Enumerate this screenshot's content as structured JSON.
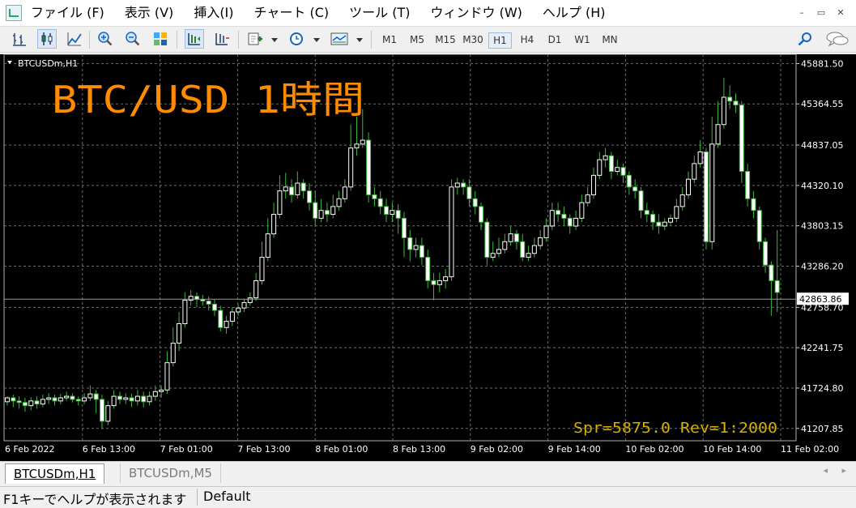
{
  "menu": {
    "items": [
      "ファイル (F)",
      "表示 (V)",
      "挿入(I)",
      "チャート (C)",
      "ツール (T)",
      "ウィンドウ (W)",
      "ヘルプ (H)"
    ],
    "window_buttons": [
      "–",
      "▭",
      "✕"
    ]
  },
  "toolbar": {
    "icons": [
      "bar-chart-icon",
      "candlestick-chart-icon",
      "line-chart-icon",
      "zoom-in-icon",
      "zoom-out-icon",
      "tile-windows-icon",
      "chart-shift-icon",
      "auto-scroll-icon",
      "new-indicator-icon",
      "periods-clock-icon",
      "templates-icon",
      "search-icon",
      "chat-icon"
    ],
    "timeframes": [
      "M1",
      "M5",
      "M15",
      "M30",
      "H1",
      "H4",
      "D1",
      "W1",
      "MN"
    ],
    "active_timeframe": "H1"
  },
  "chart": {
    "symbol_label": "BTCUSDm,H1",
    "overlay_title": "BTC/USD 1時間",
    "current_price": "42863.86",
    "spread_info": "Spr=5875.0 Rev=1:2000",
    "colors": {
      "background": "#000000",
      "bull_candle": "#ffffff",
      "bear_candle": "#ffffff",
      "wick": "#3cb83c",
      "grid": "#6e6e6e",
      "axis_text": "#ffffff",
      "title": "#ff8c00",
      "spread_text": "#d4b000"
    }
  },
  "chart_data": {
    "type": "candlestick",
    "y_ticks": [
      "45881.50",
      "45364.55",
      "44837.05",
      "44320.10",
      "43803.15",
      "43286.20",
      "42758.70",
      "42241.75",
      "41724.80",
      "41207.85"
    ],
    "x_ticks": [
      "6 Feb 2022",
      "6 Feb 13:00",
      "7 Feb 01:00",
      "7 Feb 13:00",
      "8 Feb 01:00",
      "8 Feb 13:00",
      "9 Feb 02:00",
      "9 Feb 14:00",
      "10 Feb 02:00",
      "10 Feb 14:00",
      "11 Feb 02:00"
    ],
    "ylim": [
      41050,
      46000
    ],
    "grid": true,
    "candles": [
      [
        41550,
        41600,
        41500,
        41620
      ],
      [
        41600,
        41560,
        41480,
        41640
      ],
      [
        41560,
        41540,
        41460,
        41620
      ],
      [
        41540,
        41500,
        41420,
        41600
      ],
      [
        41500,
        41560,
        41440,
        41610
      ],
      [
        41560,
        41520,
        41460,
        41620
      ],
      [
        41520,
        41580,
        41480,
        41640
      ],
      [
        41580,
        41600,
        41520,
        41660
      ],
      [
        41600,
        41560,
        41500,
        41640
      ],
      [
        41560,
        41600,
        41520,
        41650
      ],
      [
        41600,
        41620,
        41560,
        41680
      ],
      [
        41620,
        41580,
        41540,
        41660
      ],
      [
        41580,
        41560,
        41500,
        41620
      ],
      [
        41560,
        41600,
        41520,
        41660
      ],
      [
        41600,
        41650,
        41560,
        41760
      ],
      [
        41650,
        41580,
        41400,
        41700
      ],
      [
        41580,
        41300,
        41200,
        41640
      ],
      [
        41300,
        41500,
        41250,
        41560
      ],
      [
        41500,
        41620,
        41460,
        41700
      ],
      [
        41620,
        41580,
        41520,
        41680
      ],
      [
        41580,
        41600,
        41520,
        41660
      ],
      [
        41600,
        41560,
        41480,
        41650
      ],
      [
        41560,
        41620,
        41500,
        41700
      ],
      [
        41620,
        41550,
        41480,
        41680
      ],
      [
        41550,
        41620,
        41500,
        41680
      ],
      [
        41620,
        41680,
        41560,
        41760
      ],
      [
        41680,
        41700,
        41600,
        41760
      ],
      [
        41700,
        42050,
        41650,
        42200
      ],
      [
        42050,
        42300,
        42000,
        42500
      ],
      [
        42300,
        42550,
        42200,
        42700
      ],
      [
        42550,
        42850,
        42500,
        42950
      ],
      [
        42850,
        42900,
        42780,
        42980
      ],
      [
        42900,
        42860,
        42760,
        42950
      ],
      [
        42860,
        42840,
        42780,
        42920
      ],
      [
        42840,
        42800,
        42720,
        42900
      ],
      [
        42800,
        42720,
        42650,
        42860
      ],
      [
        42720,
        42500,
        42450,
        42780
      ],
      [
        42500,
        42580,
        42420,
        42650
      ],
      [
        42580,
        42700,
        42520,
        42760
      ],
      [
        42700,
        42750,
        42650,
        42800
      ],
      [
        42750,
        42820,
        42700,
        42870
      ],
      [
        42820,
        42880,
        42780,
        42950
      ],
      [
        42880,
        43100,
        42840,
        43200
      ],
      [
        43100,
        43400,
        43050,
        43600
      ],
      [
        43400,
        43700,
        43350,
        43900
      ],
      [
        43700,
        43950,
        43650,
        44100
      ],
      [
        43950,
        44250,
        43900,
        44450
      ],
      [
        44250,
        44300,
        44150,
        44480
      ],
      [
        44300,
        44200,
        44100,
        44400
      ],
      [
        44200,
        44350,
        44150,
        44500
      ],
      [
        44350,
        44250,
        44150,
        44400
      ],
      [
        44250,
        44100,
        44000,
        44350
      ],
      [
        44100,
        43900,
        43800,
        44250
      ],
      [
        43900,
        44000,
        43850,
        44150
      ],
      [
        44000,
        43950,
        43850,
        44100
      ],
      [
        43950,
        44050,
        43900,
        44200
      ],
      [
        44050,
        44150,
        44000,
        44250
      ],
      [
        44150,
        44300,
        44100,
        44400
      ],
      [
        44300,
        44800,
        44250,
        45100
      ],
      [
        44800,
        44850,
        44700,
        45200
      ],
      [
        44850,
        44900,
        44800,
        45300
      ],
      [
        44900,
        44200,
        44100,
        45000
      ],
      [
        44200,
        44150,
        44050,
        44300
      ],
      [
        44150,
        44050,
        43950,
        44250
      ],
      [
        44050,
        43950,
        43850,
        44150
      ],
      [
        43950,
        44000,
        43850,
        44100
      ],
      [
        44000,
        43900,
        43700,
        44080
      ],
      [
        43900,
        43650,
        43400,
        43980
      ],
      [
        43650,
        43500,
        43350,
        43750
      ],
      [
        43500,
        43550,
        43400,
        43650
      ],
      [
        43550,
        43400,
        43300,
        43650
      ],
      [
        43400,
        43100,
        43000,
        43500
      ],
      [
        43100,
        43050,
        42850,
        43200
      ],
      [
        43050,
        43100,
        42950,
        43200
      ],
      [
        43100,
        43150,
        43000,
        43250
      ],
      [
        43150,
        44300,
        43100,
        44400
      ],
      [
        44300,
        44350,
        44200,
        44420
      ],
      [
        44350,
        44300,
        44200,
        44400
      ],
      [
        44300,
        44150,
        44050,
        44400
      ],
      [
        44150,
        44050,
        43950,
        44250
      ],
      [
        44050,
        43850,
        43750,
        44100
      ],
      [
        43850,
        43400,
        43300,
        43900
      ],
      [
        43400,
        43450,
        43350,
        43600
      ],
      [
        43450,
        43500,
        43400,
        43650
      ],
      [
        43500,
        43600,
        43450,
        43700
      ],
      [
        43600,
        43700,
        43550,
        43800
      ],
      [
        43700,
        43600,
        43500,
        43750
      ],
      [
        43600,
        43400,
        43350,
        43700
      ],
      [
        43400,
        43450,
        43350,
        43550
      ],
      [
        43450,
        43550,
        43400,
        43650
      ],
      [
        43550,
        43650,
        43500,
        43750
      ],
      [
        43650,
        43800,
        43600,
        43900
      ],
      [
        43800,
        44000,
        43750,
        44100
      ],
      [
        44000,
        43950,
        43850,
        44100
      ],
      [
        43950,
        43900,
        43800,
        44050
      ],
      [
        43900,
        43800,
        43700,
        43950
      ],
      [
        43800,
        43900,
        43750,
        44000
      ],
      [
        43900,
        44100,
        43850,
        44200
      ],
      [
        44100,
        44200,
        44050,
        44300
      ],
      [
        44200,
        44450,
        44150,
        44550
      ],
      [
        44450,
        44650,
        44400,
        44750
      ],
      [
        44650,
        44700,
        44550,
        44800
      ],
      [
        44700,
        44500,
        44400,
        44750
      ],
      [
        44500,
        44550,
        44450,
        44650
      ],
      [
        44550,
        44450,
        44350,
        44600
      ],
      [
        44450,
        44300,
        44200,
        44500
      ],
      [
        44300,
        44250,
        44150,
        44400
      ],
      [
        44250,
        44000,
        43900,
        44300
      ],
      [
        44000,
        43950,
        43850,
        44100
      ],
      [
        43950,
        43850,
        43750,
        44000
      ],
      [
        43850,
        43800,
        43700,
        43950
      ],
      [
        43800,
        43850,
        43750,
        43900
      ],
      [
        43850,
        43900,
        43800,
        43950
      ],
      [
        43900,
        44050,
        43850,
        44150
      ],
      [
        44050,
        44200,
        44000,
        44300
      ],
      [
        44200,
        44400,
        44150,
        44500
      ],
      [
        44400,
        44600,
        44350,
        44700
      ],
      [
        44600,
        44750,
        44550,
        44900
      ],
      [
        44750,
        43600,
        43500,
        44800
      ],
      [
        43600,
        44850,
        43500,
        45200
      ],
      [
        44850,
        45100,
        44800,
        45400
      ],
      [
        45100,
        45450,
        45050,
        45700
      ],
      [
        45450,
        45400,
        45300,
        45600
      ],
      [
        45400,
        45350,
        45250,
        45500
      ],
      [
        45350,
        44500,
        44350,
        45400
      ],
      [
        44500,
        44150,
        44050,
        44600
      ],
      [
        44150,
        44000,
        43900,
        44250
      ],
      [
        44000,
        43600,
        43500,
        44050
      ],
      [
        43600,
        43300,
        43200,
        43650
      ],
      [
        43300,
        43100,
        42650,
        43350
      ],
      [
        43100,
        42950,
        42700,
        43750
      ]
    ]
  },
  "tabs": [
    {
      "label": "BTCUSDm,H1",
      "selected": true
    },
    {
      "label": "BTCUSDm,M5",
      "selected": false
    }
  ],
  "tab_scroll": [
    "◂",
    "▸"
  ],
  "status": {
    "help_text": "F1キーでヘルプが表示されます",
    "profile": "Default"
  }
}
